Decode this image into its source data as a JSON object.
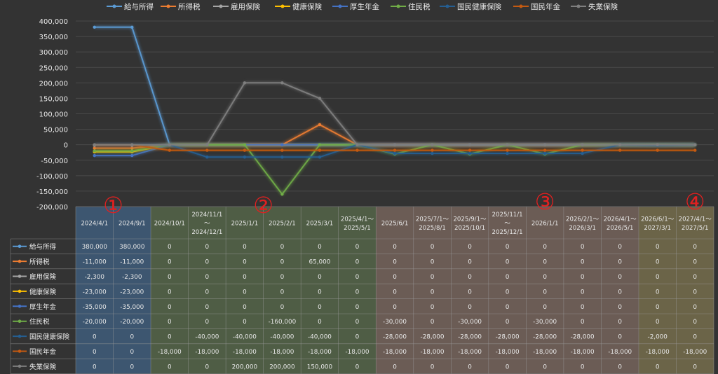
{
  "chart_data": {
    "type": "line",
    "title": "",
    "xlabel": "",
    "ylabel": "",
    "ylim": [
      -200000,
      400000
    ],
    "y_ticks": [
      400000,
      350000,
      300000,
      250000,
      200000,
      150000,
      100000,
      50000,
      0,
      -50000,
      -100000,
      -150000,
      -200000
    ],
    "y_tick_labels": [
      "400,000",
      "350,000",
      "300,000",
      "250,000",
      "200,000",
      "150,000",
      "100,000",
      "50,000",
      "0",
      "-50,000",
      "-100,000",
      "-150,000",
      "-200,000"
    ],
    "grid": true,
    "legend_position": "top",
    "categories": [
      [
        "2024/4/1"
      ],
      [
        "2024/9/1"
      ],
      [
        "2024/10/1"
      ],
      [
        "2024/11/1",
        "～",
        "2024/12/1"
      ],
      [
        "2025/1/1"
      ],
      [
        "2025/2/1"
      ],
      [
        "2025/3/1"
      ],
      [
        "2025/4/1～",
        "2025/5/1"
      ],
      [
        "2025/6/1"
      ],
      [
        "2025/7/1～",
        "2025/8/1"
      ],
      [
        "2025/9/1～",
        "2025/10/1"
      ],
      [
        "2025/11/1",
        "～",
        "2025/12/1"
      ],
      [
        "2026/1/1"
      ],
      [
        "2026/2/1～",
        "2026/3/1"
      ],
      [
        "2026/4/1～",
        "2026/5/1"
      ],
      [
        "2026/6/1～",
        "2027/3/1"
      ],
      [
        "2027/4/1～",
        "2027/5/1"
      ]
    ],
    "series": [
      {
        "name": "給与所得",
        "color": "#5b9bd5",
        "values": [
          380000,
          380000,
          0,
          0,
          0,
          0,
          0,
          0,
          0,
          0,
          0,
          0,
          0,
          0,
          0,
          0,
          0
        ],
        "cells": [
          "380,000",
          "380,000",
          "0",
          "0",
          "0",
          "0",
          "0",
          "0",
          "0",
          "0",
          "0",
          "0",
          "0",
          "0",
          "0",
          "0",
          "0"
        ]
      },
      {
        "name": "所得税",
        "color": "#ed7d31",
        "values": [
          -11000,
          -11000,
          0,
          0,
          0,
          0,
          65000,
          0,
          0,
          0,
          0,
          0,
          0,
          0,
          0,
          0,
          0
        ],
        "cells": [
          "-11,000",
          "-11,000",
          "0",
          "0",
          "0",
          "0",
          "65,000",
          "0",
          "0",
          "0",
          "0",
          "0",
          "0",
          "0",
          "0",
          "0",
          "0"
        ]
      },
      {
        "name": "雇用保険",
        "color": "#a5a5a5",
        "values": [
          -2300,
          -2300,
          0,
          0,
          0,
          0,
          0,
          0,
          0,
          0,
          0,
          0,
          0,
          0,
          0,
          0,
          0
        ],
        "cells": [
          "-2,300",
          "-2,300",
          "0",
          "0",
          "0",
          "0",
          "0",
          "0",
          "0",
          "0",
          "0",
          "0",
          "0",
          "0",
          "0",
          "0",
          "0"
        ]
      },
      {
        "name": "健康保険",
        "color": "#ffc000",
        "values": [
          -23000,
          -23000,
          0,
          0,
          0,
          0,
          0,
          0,
          0,
          0,
          0,
          0,
          0,
          0,
          0,
          0,
          0
        ],
        "cells": [
          "-23,000",
          "-23,000",
          "0",
          "0",
          "0",
          "0",
          "0",
          "0",
          "0",
          "0",
          "0",
          "0",
          "0",
          "0",
          "0",
          "0",
          "0"
        ]
      },
      {
        "name": "厚生年金",
        "color": "#4472c4",
        "values": [
          -35000,
          -35000,
          0,
          0,
          0,
          0,
          0,
          0,
          0,
          0,
          0,
          0,
          0,
          0,
          0,
          0,
          0
        ],
        "cells": [
          "-35,000",
          "-35,000",
          "0",
          "0",
          "0",
          "0",
          "0",
          "0",
          "0",
          "0",
          "0",
          "0",
          "0",
          "0",
          "0",
          "0",
          "0"
        ]
      },
      {
        "name": "住民税",
        "color": "#70ad47",
        "values": [
          -20000,
          -20000,
          0,
          0,
          0,
          -160000,
          0,
          0,
          -30000,
          0,
          -30000,
          0,
          -30000,
          0,
          0,
          0,
          0
        ],
        "cells": [
          "-20,000",
          "-20,000",
          "0",
          "0",
          "0",
          "-160,000",
          "0",
          "0",
          "-30,000",
          "0",
          "-30,000",
          "0",
          "-30,000",
          "0",
          "0",
          "0",
          "0"
        ]
      },
      {
        "name": "国民健康保険",
        "color": "#255e91",
        "values": [
          0,
          0,
          0,
          -40000,
          -40000,
          -40000,
          -40000,
          0,
          -28000,
          -28000,
          -28000,
          -28000,
          -28000,
          -28000,
          0,
          -2000,
          0
        ],
        "cells": [
          "0",
          "0",
          "0",
          "-40,000",
          "-40,000",
          "-40,000",
          "-40,000",
          "0",
          "-28,000",
          "-28,000",
          "-28,000",
          "-28,000",
          "-28,000",
          "-28,000",
          "0",
          "-2,000",
          "0"
        ]
      },
      {
        "name": "国民年金",
        "color": "#c55a11",
        "values": [
          0,
          0,
          -18000,
          -18000,
          -18000,
          -18000,
          -18000,
          -18000,
          -18000,
          -18000,
          -18000,
          -18000,
          -18000,
          -18000,
          -18000,
          -18000,
          -18000
        ],
        "cells": [
          "0",
          "0",
          "-18,000",
          "-18,000",
          "-18,000",
          "-18,000",
          "-18,000",
          "-18,000",
          "-18,000",
          "-18,000",
          "-18,000",
          "-18,000",
          "-18,000",
          "-18,000",
          "-18,000",
          "-18,000",
          "-18,000"
        ]
      },
      {
        "name": "失業保険",
        "color": "#7f7f7f",
        "values": [
          0,
          0,
          0,
          0,
          200000,
          200000,
          150000,
          0,
          0,
          0,
          0,
          0,
          0,
          0,
          0,
          0,
          0
        ],
        "cells": [
          "0",
          "0",
          "0",
          "0",
          "200,000",
          "200,000",
          "150,000",
          "0",
          "0",
          "0",
          "0",
          "0",
          "0",
          "0",
          "0",
          "0",
          "0"
        ]
      }
    ],
    "period_groups": [
      {
        "marker": "①",
        "fill": "#3d5670",
        "start": 0,
        "end": 1
      },
      {
        "marker": "②",
        "fill": "#4f5d45",
        "start": 2,
        "end": 7
      },
      {
        "marker": "③",
        "fill": "#6b5c55",
        "start": 8,
        "end": 14
      },
      {
        "marker": "④",
        "fill": "#6b6448",
        "start": 15,
        "end": 16
      }
    ],
    "marker_color": "#e02020",
    "background": "#333333",
    "grid_color": "#4a4a4a",
    "text_color": "#e8e8e8"
  }
}
